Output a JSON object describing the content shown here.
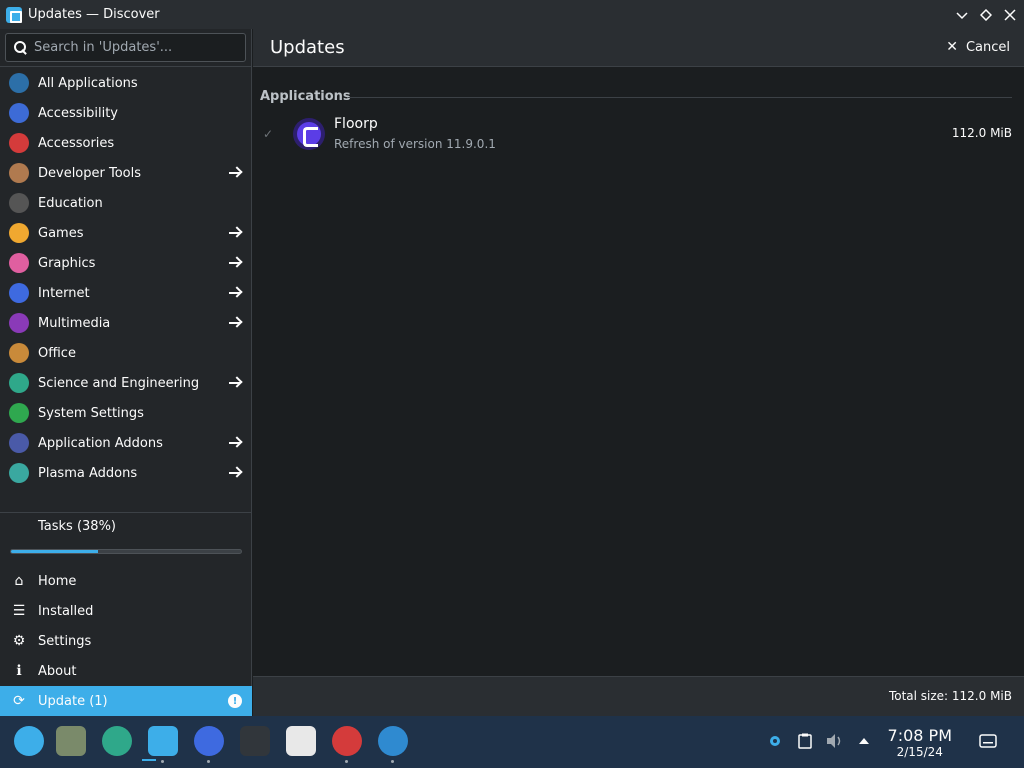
{
  "window": {
    "title": "Updates — Discover"
  },
  "sidebar": {
    "search_placeholder": "Search in 'Updates'...",
    "categories": [
      {
        "label": "All Applications",
        "icon": "grid-icon",
        "color": "#2c6fa8",
        "has_arrow": false
      },
      {
        "label": "Accessibility",
        "icon": "accessibility-icon",
        "color": "#3d6bd6",
        "has_arrow": false
      },
      {
        "label": "Accessories",
        "icon": "toolbox-icon",
        "color": "#d43b3b",
        "has_arrow": false
      },
      {
        "label": "Developer Tools",
        "icon": "hammer-icon",
        "color": "#b07a4f",
        "has_arrow": true
      },
      {
        "label": "Education",
        "icon": "graduation-cap-icon",
        "color": "#555555",
        "has_arrow": false
      },
      {
        "label": "Games",
        "icon": "gamepad-icon",
        "color": "#f0a830",
        "has_arrow": true
      },
      {
        "label": "Graphics",
        "icon": "palette-icon",
        "color": "#e05fa0",
        "has_arrow": true
      },
      {
        "label": "Internet",
        "icon": "globe-icon",
        "color": "#3e6ae0",
        "has_arrow": true
      },
      {
        "label": "Multimedia",
        "icon": "film-icon",
        "color": "#8a3ab8",
        "has_arrow": true
      },
      {
        "label": "Office",
        "icon": "briefcase-icon",
        "color": "#c98a3a",
        "has_arrow": false
      },
      {
        "label": "Science and Engineering",
        "icon": "atom-icon",
        "color": "#2fa88a",
        "has_arrow": true
      },
      {
        "label": "System Settings",
        "icon": "settings-icon",
        "color": "#2fa84f",
        "has_arrow": false
      },
      {
        "label": "Application Addons",
        "icon": "addons-icon",
        "color": "#4a5aa8",
        "has_arrow": true
      },
      {
        "label": "Plasma Addons",
        "icon": "plasma-icon",
        "color": "#3aa8a0",
        "has_arrow": true
      }
    ],
    "tasks": {
      "label": "Tasks (38%)",
      "progress": 0.38
    },
    "nav": [
      {
        "label": "Home",
        "icon": "home-icon"
      },
      {
        "label": "Installed",
        "icon": "list-icon"
      },
      {
        "label": "Settings",
        "icon": "gear-icon"
      },
      {
        "label": "About",
        "icon": "info-icon"
      },
      {
        "label": "Update (1)",
        "icon": "update-icon",
        "active": true,
        "alert": "!"
      }
    ]
  },
  "main": {
    "title": "Updates",
    "cancel_label": "Cancel",
    "section_title": "Applications",
    "updates": [
      {
        "name": "Floorp",
        "description": "Refresh of version 11.9.0.1",
        "size": "112.0 MiB",
        "icon": "floorp-icon"
      }
    ],
    "total_size": "Total size: 112.0 MiB"
  },
  "taskbar": {
    "apps": [
      {
        "name": "application-launcher-icon",
        "color": "#3daee9"
      },
      {
        "name": "notes-icon",
        "color": "#7a8a6a"
      },
      {
        "name": "plugin-icon",
        "color": "#2fa88a"
      },
      {
        "name": "discover-icon",
        "color": "#3daee9"
      },
      {
        "name": "browser-icon",
        "color": "#3e6ae0"
      },
      {
        "name": "terminal-icon",
        "color": "#31363b"
      },
      {
        "name": "vivaldi-icon",
        "color": "#e8e8e8"
      },
      {
        "name": "chrome-dev-icon",
        "color": "#d43b3b"
      },
      {
        "name": "edge-dev-icon",
        "color": "#2f8ad0"
      }
    ],
    "clock": {
      "time": "7:08 PM",
      "date": "2/15/24"
    }
  },
  "colors": {
    "accent": "#3daee9",
    "background": "#1b1e20",
    "sidebar": "#232629"
  }
}
